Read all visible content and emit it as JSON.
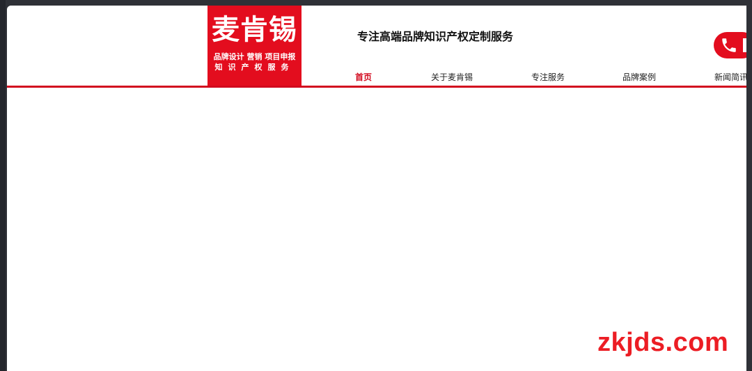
{
  "logo": {
    "main": "麦肯锡",
    "sub_line1": "品牌设计 营销 项目申报",
    "sub_line2": "知识产权服务"
  },
  "slogan": "专注高端品牌知识产权定制服务",
  "nav": {
    "items": [
      {
        "label": "首页",
        "active": true
      },
      {
        "label": "关于麦肯锡",
        "active": false
      },
      {
        "label": "专注服务",
        "active": false
      },
      {
        "label": "品牌案例",
        "active": false
      },
      {
        "label": "新闻简讯",
        "active": false
      }
    ]
  },
  "watermark": "zkjds.com",
  "colors": {
    "brand_red": "#e30d1e",
    "nav_active": "#d20a1e",
    "watermark": "#ec1d24"
  },
  "icons": {
    "phone": "phone-icon"
  }
}
